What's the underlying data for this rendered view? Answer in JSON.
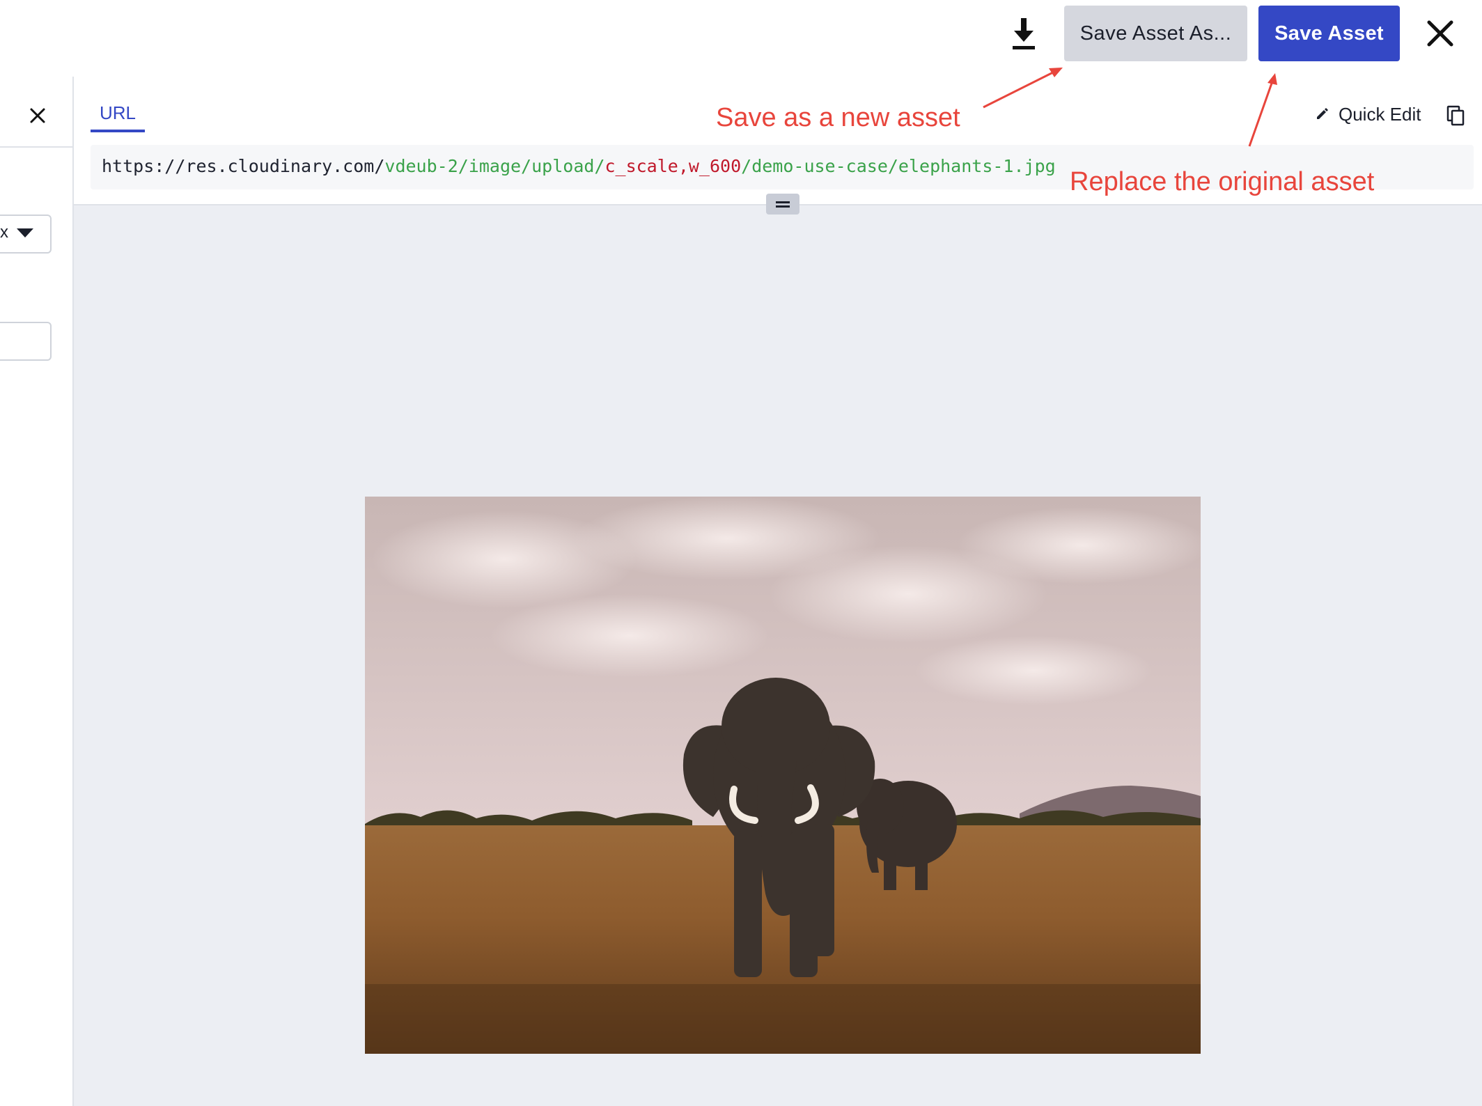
{
  "toolbar": {
    "download_icon": "download-icon",
    "save_as_label": "Save Asset As...",
    "save_label": "Save Asset",
    "close_icon": "close-icon",
    "accent_color": "#3448c5"
  },
  "left_panel": {
    "close_icon": "close-icon",
    "format_select_value": "x",
    "format_select_icon": "caret-down-icon",
    "input_value": ""
  },
  "url_panel": {
    "tab_label": "URL",
    "quick_edit_label": "Quick Edit",
    "quick_edit_icon": "pencil-icon",
    "copy_icon": "copy-icon",
    "url": {
      "base": "https://res.cloudinary.com/",
      "cloud_path": "vdeub-2/image/upload/",
      "transformation": "c_scale,w_600",
      "sep": "/",
      "public_id": "demo-use-case/elephants-1.jpg",
      "colors": {
        "path": "#3aa24a",
        "transformation": "#c0192b"
      }
    },
    "resize_handle_icon": "drag-handle-icon"
  },
  "annotations": {
    "save_as_note": "Save as a new asset",
    "save_note": "Replace the original asset",
    "color": "#e8453c"
  },
  "preview": {
    "subject": "elephants-photo"
  }
}
